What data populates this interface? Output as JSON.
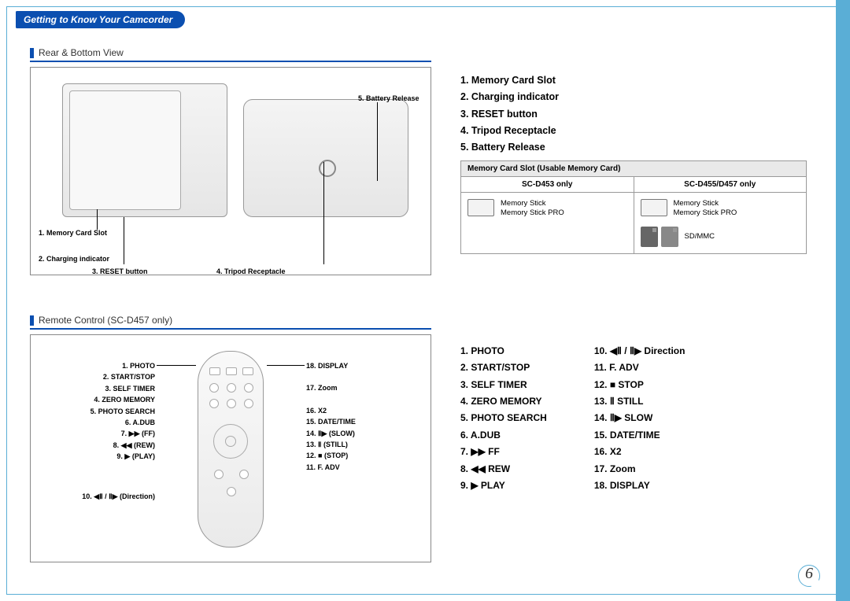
{
  "header": {
    "title": "Getting to Know Your Camcorder"
  },
  "page_number": "6",
  "section1": {
    "title": "Rear & Bottom View",
    "labels": {
      "l1": "1. Memory Card Slot",
      "l2": "2. Charging indicator",
      "l3": "3. RESET button",
      "l4": "4. Tripod Receptacle",
      "l5": "5. Battery Release"
    },
    "legend": {
      "i1": "1. Memory Card Slot",
      "i2": "2. Charging indicator",
      "i3": "3. RESET button",
      "i4": "4. Tripod Receptacle",
      "i5": "5. Battery Release"
    },
    "memtable": {
      "header": "Memory Card Slot (Usable Memory Card)",
      "colA": "SC-D453 only",
      "colB": "SC-D455/D457 only",
      "a_text1": "Memory Stick",
      "a_text2": "Memory Stick PRO",
      "b_text1": "Memory Stick",
      "b_text2": "Memory Stick PRO",
      "b_text3": "SD/MMC"
    }
  },
  "section2": {
    "title": "Remote Control (SC-D457 only)",
    "left_labels": {
      "l1": "1. PHOTO",
      "l2": "2. START/STOP",
      "l3": "3. SELF TIMER",
      "l4": "4. ZERO MEMORY",
      "l5": "5. PHOTO SEARCH",
      "l6": "6. A.DUB",
      "l7": "7. ▶▶ (FF)",
      "l8": "8. ◀◀ (REW)",
      "l9": "9. ▶ (PLAY)",
      "l10": "10. ◀Ⅱ / Ⅱ▶ (Direction)"
    },
    "right_labels": {
      "r18": "18. DISPLAY",
      "r17": "17. Zoom",
      "r16": "16. X2",
      "r15": "15. DATE/TIME",
      "r14": "14. Ⅱ▶ (SLOW)",
      "r13": "13. Ⅱ (STILL)",
      "r12": "12. ■ (STOP)",
      "r11": "11. F. ADV"
    },
    "legend_colA": {
      "i1": "1. PHOTO",
      "i2": "2. START/STOP",
      "i3": "3. SELF TIMER",
      "i4": "4. ZERO MEMORY",
      "i5": "5. PHOTO SEARCH",
      "i6": "6. A.DUB",
      "i7": "7. ▶▶ FF",
      "i8": "8. ◀◀ REW",
      "i9": "9. ▶ PLAY"
    },
    "legend_colB": {
      "i10": "10. ◀Ⅱ / Ⅱ▶ Direction",
      "i11": "11. F. ADV",
      "i12": "12. ■ STOP",
      "i13": "13. Ⅱ STILL",
      "i14": "14. Ⅱ▶ SLOW",
      "i15": "15. DATE/TIME",
      "i16": "16. X2",
      "i17": "17. Zoom",
      "i18": "18. DISPLAY"
    }
  }
}
